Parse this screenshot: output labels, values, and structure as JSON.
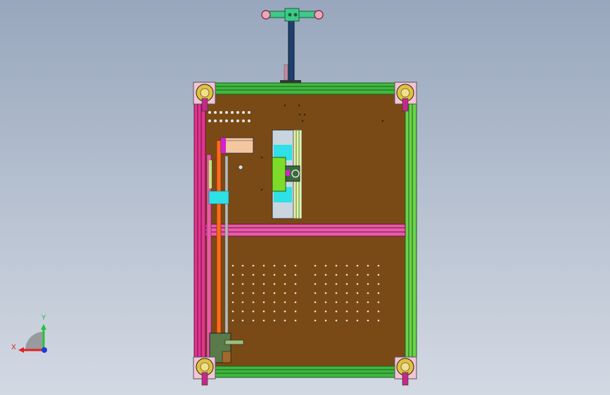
{
  "viewport": {
    "background_top": "#98a7bd",
    "background_bottom": "#d3d9e3"
  },
  "model": {
    "plate_color": "#7a4a16",
    "frame_magenta": "#e0358e",
    "frame_green": "#3fb83f",
    "frame_dark_green": "#2e8b3a",
    "crossbar_pink": "#e85aa8",
    "cyan_block": "#2fe0e6",
    "lime_block": "#7ddc2a",
    "orange_rail": "#ff6a1a",
    "corner_pink": "#f3c4d6",
    "caster_yellow": "#e3c23a",
    "handle_color": "#1f3f6e",
    "handle_top_color": "#3ec98a"
  },
  "triad": {
    "x_label": "X",
    "y_label": "Y",
    "x_color": "#e02020",
    "y_color": "#22c43a",
    "z_color": "#1f3bd6"
  }
}
